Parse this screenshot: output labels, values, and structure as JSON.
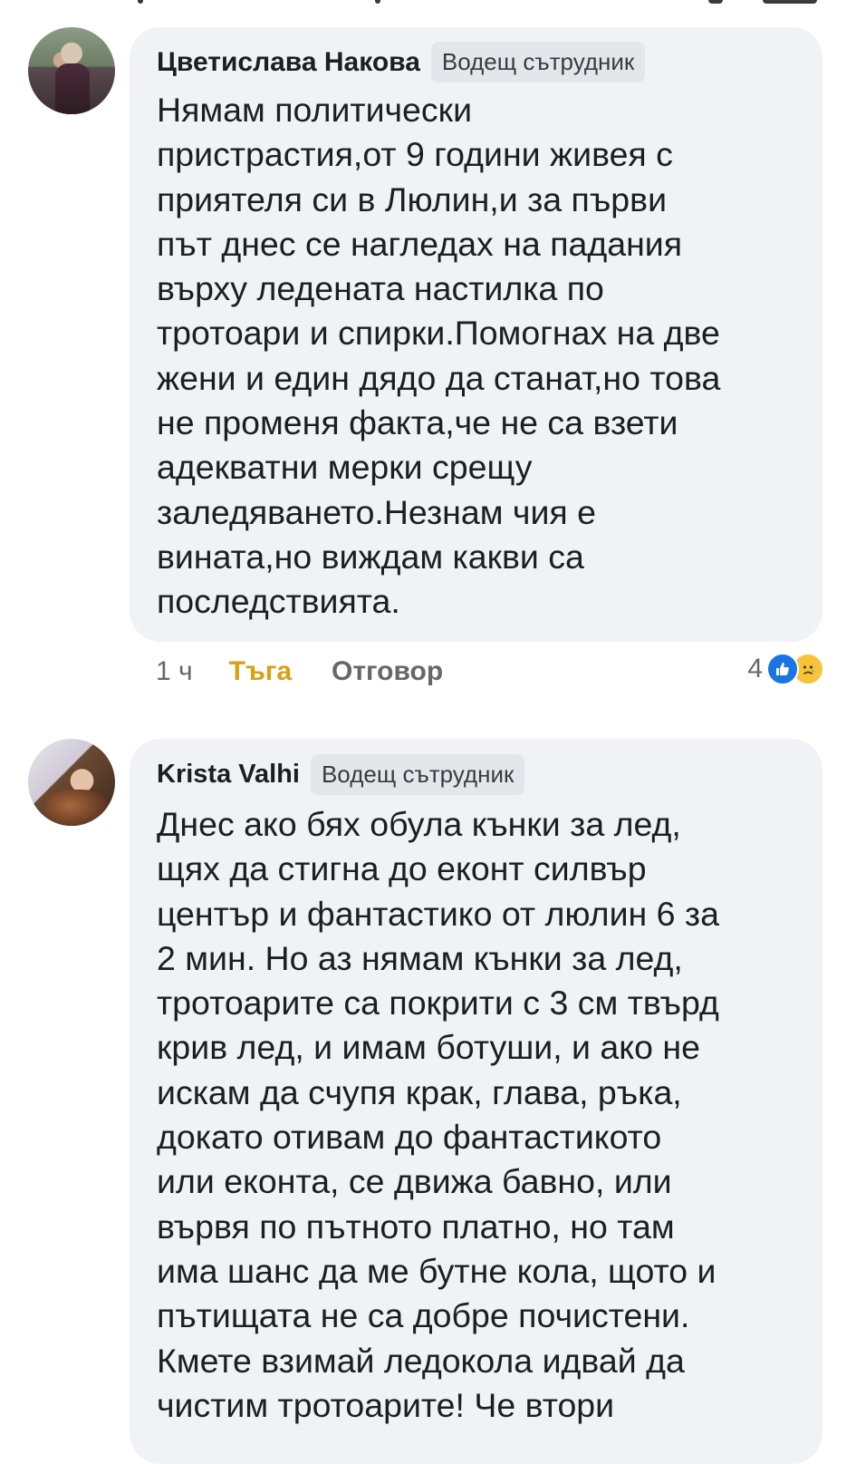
{
  "comments": [
    {
      "author": "Цветислава Накова",
      "badge": "Водещ сътрудник",
      "text": "Нямам политически\nпристрастия,от 9 години живея с\nприятеля си в Люлин,и за първи\nпът днес се нагледах на падания\nвърху ледената настилка по\nтротоари и спирки.Помогнах на две\nжени и един дядо да станат,но това\nне променя факта,че не са взети\nадекватни мерки срещу\nзаледяването.Незнам чия е\nвината,но виждам какви са\nпоследствията.",
      "time": "1 ч",
      "like_label": "Тъга",
      "reply_label": "Отговор",
      "reaction_count": "4",
      "reactions": [
        "like-icon",
        "sad-icon"
      ]
    },
    {
      "author": "Krista Valhi",
      "badge": "Водещ сътрудник",
      "text": "Днес ако бях обула кънки за лед,\nщях да стигна до еконт силвър\nцентър и фантастико от люлин 6 за\n2 мин. Но аз нямам кънки за лед,\nтротоарите са покрити с 3 см твърд\nкрив лед, и имам ботуши, и ако не\nискам да счупя крак, глава, ръка,\nдокато отивам до фантастикото\nили еконта, се движа бавно, или\nвървя по пътното платно, но там\nима шанс да ме бутне кола, щото и\nпътищата не са добре почистени.\nКмете взимай ледокола идвай да\nчистим тротоарите! Че втори"
    }
  ],
  "colors": {
    "bubble": "#f0f2f5",
    "badge": "#e4e6eb",
    "text": "#1c1e21",
    "secondary": "#65676b",
    "reaction_active": "#d8a012",
    "like_blue": "#1b74e4",
    "sad_yellow": "#f7c33b"
  }
}
